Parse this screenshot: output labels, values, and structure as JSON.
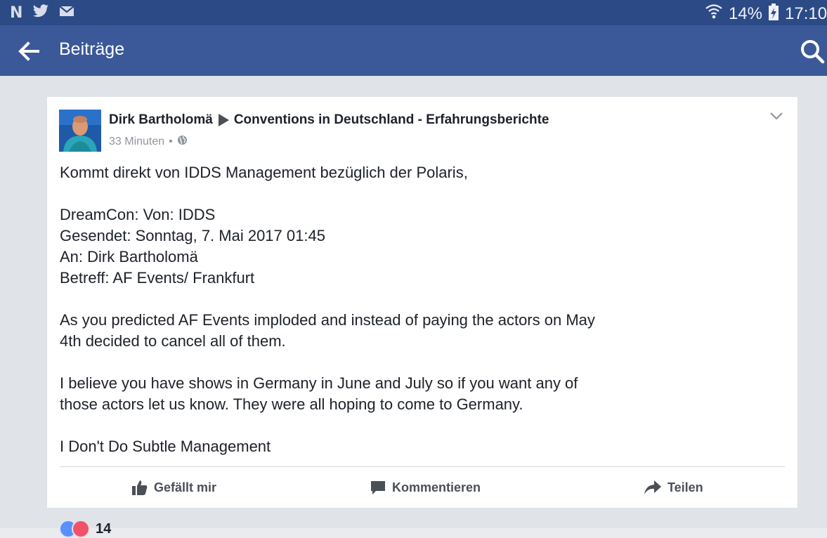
{
  "status_bar": {
    "battery": "14%",
    "time": "17:10"
  },
  "app_bar": {
    "title": "Beiträge"
  },
  "post": {
    "author": "Dirk Bartholomä",
    "group": "Conventions in Deutschland - Erfahrungsberichte",
    "time": "33 Minuten",
    "privacy_icon": "globe-icon",
    "paragraphs": [
      [
        "Kommt direkt von IDDS Management bezüglich der Polaris,"
      ],
      [
        "DreamCon: Von: IDDS",
        "Gesendet: Sonntag, 7. Mai 2017 01:45",
        "An: Dirk Bartholomä",
        "Betreff: AF Events/ Frankfurt"
      ],
      [
        "As you predicted AF Events imploded and instead of paying the actors on May",
        "4th decided to cancel all of them."
      ],
      [
        "I believe you have shows in Germany in June and July so if you want any of",
        "those actors let us know. They were all hoping to come to Germany."
      ],
      [
        "I Don't Do Subtle Management"
      ]
    ]
  },
  "actions": {
    "like_label": "Gefällt mir",
    "comment_label": "Kommentieren",
    "share_label": "Teilen"
  },
  "reactions": {
    "count": "14"
  },
  "colors": {
    "status_bar": "#2c4a86",
    "app_bar": "#3b5998",
    "background": "#e0e3e8"
  }
}
